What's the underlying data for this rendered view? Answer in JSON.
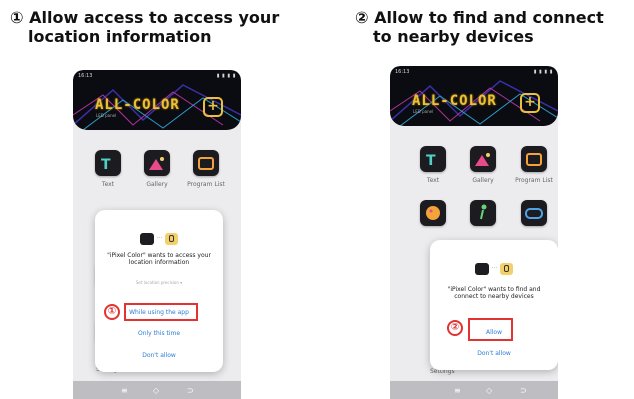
{
  "step1": {
    "number": "①",
    "title_line1": "Allow access to access your",
    "title_line2": "location information"
  },
  "step2": {
    "number": "②",
    "title_line1": "Allow to find and connect",
    "title_line2": "to nearby devices"
  },
  "phone_common": {
    "time": "16:13",
    "logo_text": "ALL-COLOR",
    "logo_subtitle": "LED panel",
    "add_symbol": "+",
    "tiles": [
      "Text",
      "Gallery",
      "Program List"
    ],
    "settings_label": "Settings",
    "nav": [
      "≡",
      "◇",
      "⊃"
    ]
  },
  "dialog_left": {
    "message": "\"iPixel Color\" wants to access your location information",
    "hint": "Set location precision ▾",
    "options": [
      "While using the app",
      "Only this time",
      "Don't allow"
    ],
    "badge": "①"
  },
  "dialog_right": {
    "message": "\"iPixel Color\" wants to find and connect to nearby devices",
    "options": [
      "Allow",
      "Don't allow"
    ],
    "badge": "②"
  },
  "colors": {
    "highlight": "#e23232",
    "link_blue": "#2e7bd6",
    "logo_gold": "#e9c23a"
  }
}
